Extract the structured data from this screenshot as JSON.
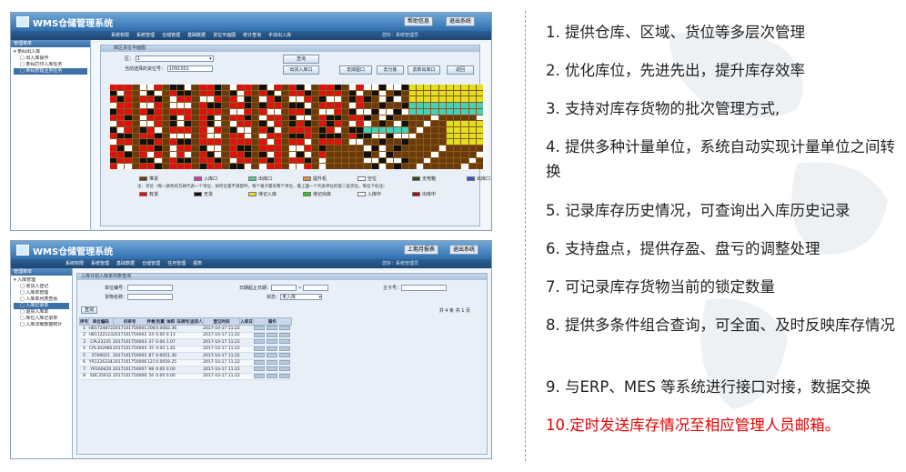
{
  "screenshot1": {
    "window_title": "WMS仓储管理系统",
    "title_buttons": [
      "帮助信息",
      "退出系统"
    ],
    "nav_menu": [
      "系统权限",
      "系统管理",
      "仓储管理",
      "基础数据",
      "货位平面图",
      "统计查询",
      "手动出入库"
    ],
    "user_info": "您好：系统管理员",
    "sidebar_header": "管理菜单",
    "tree": [
      {
        "label": "条码出入库",
        "level": 0,
        "selected": false
      },
      {
        "label": "出入库操作",
        "level": 1,
        "selected": false
      },
      {
        "label": "条码打印入库任务",
        "level": 1,
        "selected": false
      },
      {
        "label": "条码管理业务任务",
        "level": 1,
        "selected": true
      }
    ],
    "panel_title": "库区货位平面图",
    "form": {
      "area_label": "区：",
      "area_value": "1",
      "pos_label": "当前选择的货位号：",
      "pos_value": "1091001"
    },
    "buttons": {
      "query": "查询",
      "outbound": "出货入库口",
      "goto_wh": "去掉屋口",
      "goto_sort": "去分拣",
      "goto_new": "去新出库口",
      "back": "返回"
    },
    "legend_row1": [
      {
        "label": "堆货",
        "color": "#6b3b0c"
      },
      {
        "label": "入库口",
        "color": "#d63ab0"
      },
      {
        "label": "出库口",
        "color": "#48d08c"
      },
      {
        "label": "提升机",
        "color": "#e58f3b"
      },
      {
        "label": "空位",
        "color": "#ffffff"
      },
      {
        "label": "无电箱",
        "color": "#3c4a1e"
      },
      {
        "label": "出库口",
        "color": "#3457c8"
      }
    ],
    "note": "注：货位（每一颜色的方格代表一个单位，如何位置不清楚时，每个格子最有两个单位，最上面一个代表单位的第二层货位，每位下标注）",
    "legend_row2": [
      {
        "label": "有货",
        "color": "#e01010"
      },
      {
        "label": "无货",
        "color": "#101010"
      },
      {
        "label": "待记入库",
        "color": "#e0e020"
      },
      {
        "label": "待记出库",
        "color": "#30c030"
      },
      {
        "label": "入库中",
        "color": "#ffffff"
      },
      {
        "label": "出库中",
        "color": "#a01010"
      }
    ]
  },
  "screenshot2": {
    "window_title": "WMS仓储管理系统",
    "title_buttons": [
      "上期月报表",
      "退出系统"
    ],
    "nav_menu": [
      "系统权限",
      "系统管理",
      "基础数据",
      "仓储管理",
      "任务管理",
      "报表"
    ],
    "user_info": "您好：系统管理员",
    "sidebar_header": "管理菜单",
    "tree": [
      {
        "label": "入库管理",
        "level": 0,
        "selected": false
      },
      {
        "label": "收货入登记",
        "level": 1,
        "selected": false
      },
      {
        "label": "入库单管理",
        "level": 1,
        "selected": false
      },
      {
        "label": "入库单列表查看",
        "level": 1,
        "selected": false
      },
      {
        "label": "入库记录单",
        "level": 1,
        "selected": true
      },
      {
        "label": "退货入库单",
        "level": 1,
        "selected": false
      },
      {
        "label": "库位入库记录单",
        "level": 1,
        "selected": false
      },
      {
        "label": "入库详细数据统计",
        "level": 1,
        "selected": false
      }
    ],
    "panel_title": "入库计划入库单列表查询",
    "form": {
      "f1": "单位编号：",
      "f2": "日期起止日期：",
      "f3": "主卡号：",
      "f4": "货物名称：",
      "f5": "状态：",
      "f5_value": "未入库"
    },
    "search_label": "查询",
    "pager": "共 4 条 共 1 页",
    "table_headers": [
      "序号",
      "单位编码",
      "内审号",
      "件数",
      "毛重",
      "体积",
      "车牌号",
      "送货人",
      "登记时间",
      "入库日",
      "操作"
    ],
    "table_rows": [
      [
        "1",
        "HB1724872",
        "2017101750001",
        "200",
        "0.00",
        "82.36",
        "",
        "",
        "2017-10-17 11:22",
        ""
      ],
      [
        "2",
        "HB1122123",
        "2017101750002",
        "24",
        "0.00",
        "0.13",
        "",
        "",
        "2017-10-17 11:22",
        ""
      ],
      [
        "3",
        "CPL22235",
        "2017101750003",
        "37",
        "0.00",
        "1.07",
        "",
        "",
        "2017-10-17 11:22",
        ""
      ],
      [
        "4",
        "CPL30298S",
        "2017101750004",
        "35",
        "0.00",
        "1.42",
        "",
        "",
        "2017-10-17 11:22",
        ""
      ],
      [
        "5",
        "ST09021",
        "2017101750005",
        "87",
        "0.00",
        "51.30",
        "",
        "",
        "2017-10-17 11:22",
        ""
      ],
      [
        "6",
        "YR1226334",
        "2017101750006",
        "121",
        "0.00",
        "59.25",
        "",
        "",
        "2017-10-17 11:22",
        ""
      ],
      [
        "7",
        "YR160420",
        "2017101750007",
        "98",
        "0.00",
        "0.00",
        "",
        "",
        "2017-10-17 11:22",
        ""
      ],
      [
        "8",
        "SDC35632",
        "2017101750008",
        "56",
        "0.00",
        "0.00",
        "",
        "",
        "2017-10-17 11:22",
        ""
      ]
    ]
  },
  "features": [
    {
      "text": "1. 提供仓库、区域、货位等多层次管理",
      "highlight": false
    },
    {
      "text": "2. 优化库位，先进先出，提升库存效率",
      "highlight": false
    },
    {
      "text": "3. 支持对库存货物的批次管理方式,",
      "highlight": false
    },
    {
      "text": "4. 提供多种计量单位，系统自动实现计量单位之间转换",
      "highlight": false
    },
    {
      "text": "5. 记录库存历史情况，可查询出入库历史记录",
      "highlight": false
    },
    {
      "text": "6. 支持盘点，提供存盈、盘亏的调整处理",
      "highlight": false
    },
    {
      "text": "7. 可记录库存货物当前的锁定数量",
      "highlight": false
    },
    {
      "text": "8. 提供多条件组合查询，可全面、及时反映库存情况",
      "highlight": false
    },
    {
      "text": "9. 与ERP、MES 等系统进行接口对接，数据交换",
      "highlight": false
    },
    {
      "text": "10.定时发送库存情况至相应管理人员邮箱。",
      "highlight": true
    }
  ]
}
